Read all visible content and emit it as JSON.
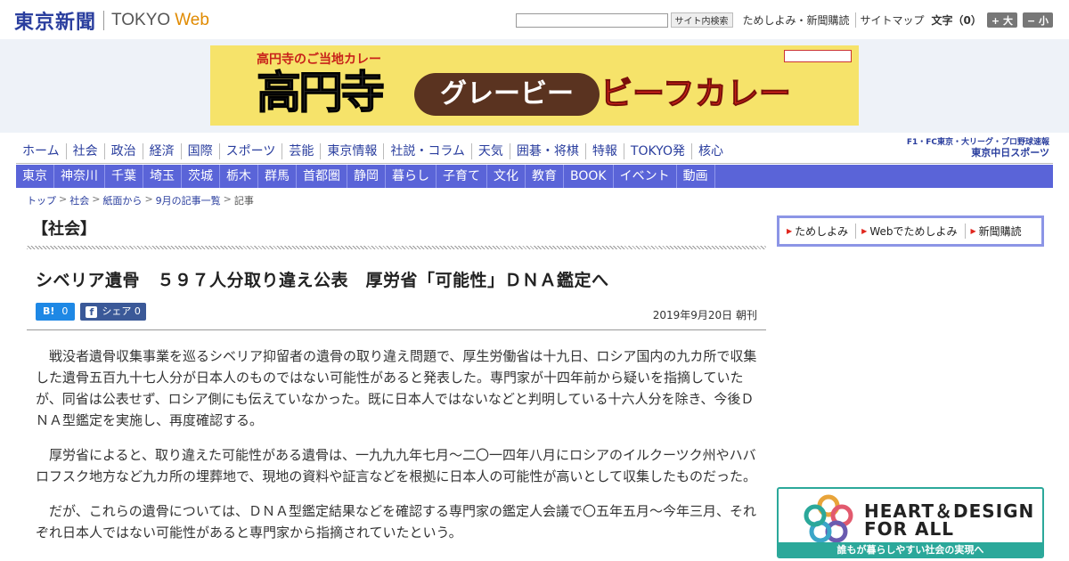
{
  "header": {
    "logo_jp": "東京新聞",
    "logo_tokyo": "TOKYO",
    "logo_web": "Web",
    "search_button": "サイト内検索",
    "links": [
      "ためしよみ・新聞購読",
      "サイトマップ"
    ],
    "font_size_label": "文字（0）",
    "font_bigger": "+ 大",
    "font_smaller": "− 小"
  },
  "ad": {
    "sub": "高円寺のご当地カレー",
    "kouenji": "高円寺",
    "gravy": "グレービー",
    "beef_curry": "ビーフカレー"
  },
  "nav_main": [
    "ホーム",
    "社会",
    "政治",
    "経済",
    "国際",
    "スポーツ",
    "芸能",
    "東京情報",
    "社説・コラム",
    "天気",
    "囲碁・将棋",
    "特報",
    "TOKYO発",
    "核心"
  ],
  "sports_logo": {
    "line1": "F1・FC東京・大リーグ・プロ野球速報",
    "line2": "東京中日スポーツ"
  },
  "nav_sub": [
    "東京",
    "神奈川",
    "千葉",
    "埼玉",
    "茨城",
    "栃木",
    "群馬",
    "首都圏",
    "静岡",
    "暮らし",
    "子育て",
    "文化",
    "教育",
    "BOOK",
    "イベント",
    "動画"
  ],
  "breadcrumb": [
    "トップ",
    "社会",
    "紙面から",
    "9月の記事一覧",
    "記事"
  ],
  "article": {
    "section": "【社会】",
    "headline": "シベリア遺骨　５９７人分取り違え公表　厚労省「可能性」ＤＮＡ鑑定へ",
    "hatebu_label": "B!",
    "hatebu_count": "0",
    "fb_icon": "f",
    "fb_label": "シェア",
    "fb_count": "0",
    "date": "2019年9月20日 朝刊",
    "paragraphs": [
      "戦没者遺骨収集事業を巡るシベリア抑留者の遺骨の取り違え問題で、厚生労働省は十九日、ロシア国内の九カ所で収集した遺骨五百九十七人分が日本人のものではない可能性があると発表した。専門家が十四年前から疑いを指摘していたが、同省は公表せず、ロシア側にも伝えていなかった。既に日本人ではないなどと判明している十六人分を除き、今後ＤＮＡ型鑑定を実施し、再度確認する。",
      "厚労省によると、取り違えた可能性がある遺骨は、一九九九年七月～二〇一四年八月にロシアのイルクーツク州やハバロフスク地方など九カ所の埋葬地で、現地の資料や証言などを根拠に日本人の可能性が高いとして収集したものだった。",
      "だが、これらの遺骨については、ＤＮＡ型鑑定結果などを確認する専門家の鑑定人会議で〇五年五月～今年三月、それぞれ日本人ではない可能性があると専門家から指摘されていたという。"
    ]
  },
  "sidebar": {
    "links": [
      "ためしよみ",
      "Webでためしよみ",
      "新聞購読"
    ],
    "heart_ad": {
      "line1": "HEART＆DESIGN",
      "line2": "FOR ALL",
      "strip": "誰もが暮らしやすい社会の実現へ"
    }
  },
  "colors": {
    "brand_blue": "#2a3e9e",
    "nav_sub_bg": "#5a64d8",
    "accent_red": "#e0261d",
    "teal": "#2ba89a"
  }
}
